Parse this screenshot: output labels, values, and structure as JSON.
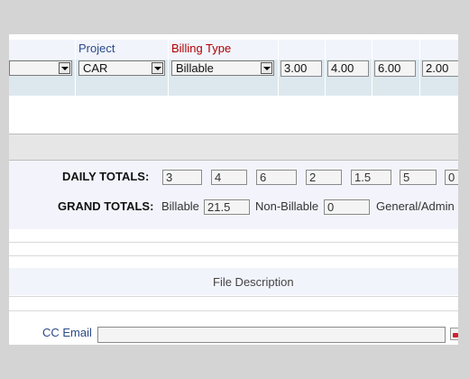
{
  "timesheet": {
    "project_header": "Project",
    "billing_header": "Billing Type",
    "project_value": "CAR",
    "billing_value": "Billable",
    "hours": [
      "3.00",
      "4.00",
      "6.00",
      "2.00"
    ]
  },
  "totals": {
    "daily_label": "DAILY TOTALS:",
    "daily_values": [
      "3",
      "4",
      "6",
      "2",
      "1.5",
      "5",
      "0"
    ],
    "grand_label": "GRAND TOTALS:",
    "billable_label": "Billable",
    "billable_value": "21.5",
    "nonbillable_label": "Non-Billable",
    "nonbillable_value": "0",
    "general_admin_label": "General/Admin"
  },
  "files": {
    "file_description_label": "File Description"
  },
  "email": {
    "cc_label": "CC Email",
    "cc_value": ""
  },
  "icons": {
    "address_book": "address-book-icon",
    "dropdown": "chevron-down-icon"
  }
}
